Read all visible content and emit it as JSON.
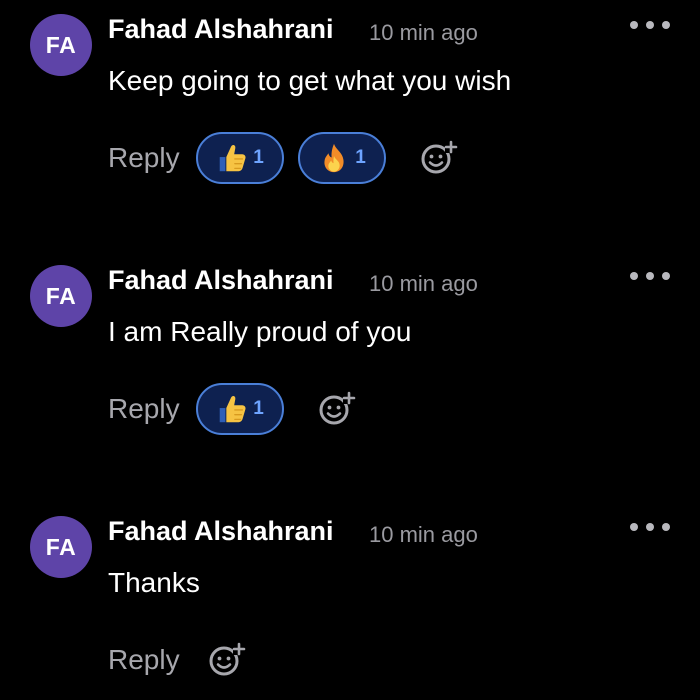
{
  "comments": [
    {
      "avatar_initials": "FA",
      "author": "Fahad Alshahrani",
      "time": "10 min ago",
      "text": "Keep going to get what you wish",
      "reply_label": "Reply",
      "reactions": [
        {
          "icon": "thumbs-up-emoji",
          "count": "1"
        },
        {
          "icon": "fire-emoji",
          "count": "1"
        }
      ]
    },
    {
      "avatar_initials": "FA",
      "author": "Fahad Alshahrani",
      "time": "10 min ago",
      "text": "I am Really proud of you",
      "reply_label": "Reply",
      "reactions": [
        {
          "icon": "thumbs-up-emoji",
          "count": "1"
        }
      ]
    },
    {
      "avatar_initials": "FA",
      "author": "Fahad Alshahrani",
      "time": "10 min ago",
      "text": "Thanks",
      "reply_label": "Reply",
      "reactions": []
    }
  ],
  "colors": {
    "background": "#000000",
    "avatar": "#5e44a8",
    "reaction_border": "#4a7fd8",
    "reaction_fill": "#0e2150",
    "reaction_count": "#6ea4ff",
    "muted_text": "#9a9aa0"
  }
}
